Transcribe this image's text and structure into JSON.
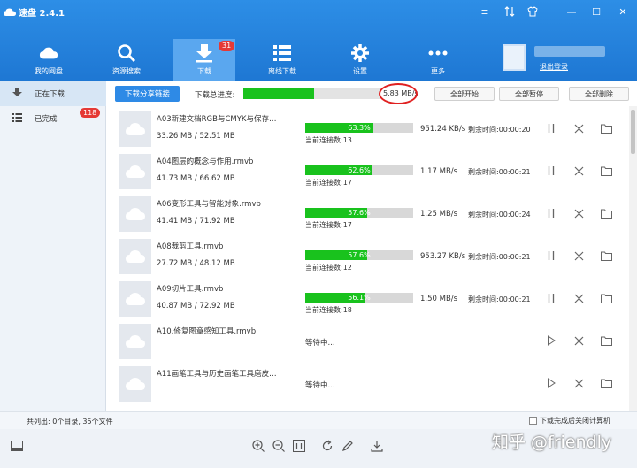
{
  "app": {
    "title": "速盘 2.4.1"
  },
  "nav": [
    {
      "label": "我的网盘",
      "icon": "cloud-icon"
    },
    {
      "label": "资源搜索",
      "icon": "search-icon"
    },
    {
      "label": "下载",
      "icon": "download-icon",
      "badge": "31",
      "active": true
    },
    {
      "label": "离线下载",
      "icon": "list-icon"
    },
    {
      "label": "设置",
      "icon": "gear-icon"
    },
    {
      "label": "更多",
      "icon": "more-icon"
    }
  ],
  "user": {
    "logout": "退出登录"
  },
  "sidebar": [
    {
      "label": "正在下载",
      "icon": "downloading-icon",
      "active": true
    },
    {
      "label": "已完成",
      "icon": "completed-list-icon",
      "badge": "118"
    }
  ],
  "toolbar": {
    "share_label": "下载分享链接",
    "total_label": "下载总进度:",
    "total_progress": 0.52,
    "total_speed": "5.83 MB/s",
    "start_all": "全部开始",
    "pause_all": "全部暂停",
    "delete_all": "全部删除"
  },
  "downloads": [
    {
      "name": "A03新建文档RGB与CMYK与保存…",
      "size": "33.26 MB / 52.51 MB",
      "progress": 0.633,
      "pct": "63.3%",
      "connections": "当前连接数:13",
      "speed": "951.24 KB/s",
      "remaining": "剩余时间:00:00:20"
    },
    {
      "name": "A04图层的概念与作用.rmvb",
      "size": "41.73 MB / 66.62 MB",
      "progress": 0.626,
      "pct": "62.6%",
      "connections": "当前连接数:17",
      "speed": "1.17 MB/s",
      "remaining": "剩余时间:00:00:21"
    },
    {
      "name": "A06变形工具与智能对象.rmvb",
      "size": "41.41 MB / 71.92 MB",
      "progress": 0.576,
      "pct": "57.6%",
      "connections": "当前连接数:17",
      "speed": "1.25 MB/s",
      "remaining": "剩余时间:00:00:24"
    },
    {
      "name": "A08裁剪工具.rmvb",
      "size": "27.72 MB / 48.12 MB",
      "progress": 0.576,
      "pct": "57.6%",
      "connections": "当前连接数:12",
      "speed": "953.27 KB/s",
      "remaining": "剩余时间:00:00:21"
    },
    {
      "name": "A09切片工具.rmvb",
      "size": "40.87 MB / 72.92 MB",
      "progress": 0.561,
      "pct": "56.1%",
      "connections": "当前连接数:18",
      "speed": "1.50 MB/s",
      "remaining": "剩余时间:00:00:21"
    },
    {
      "name": "A10.修复图章感知工具.rmvb",
      "status": "等待中..."
    },
    {
      "name": "A11画笔工具与历史画笔工具磨皮…",
      "status": "等待中..."
    }
  ],
  "status": {
    "summary": "共列出: 0个目录, 35个文件",
    "shutdown_label": "下载完成后关闭计算机"
  },
  "watermark": "知乎 @friendly"
}
